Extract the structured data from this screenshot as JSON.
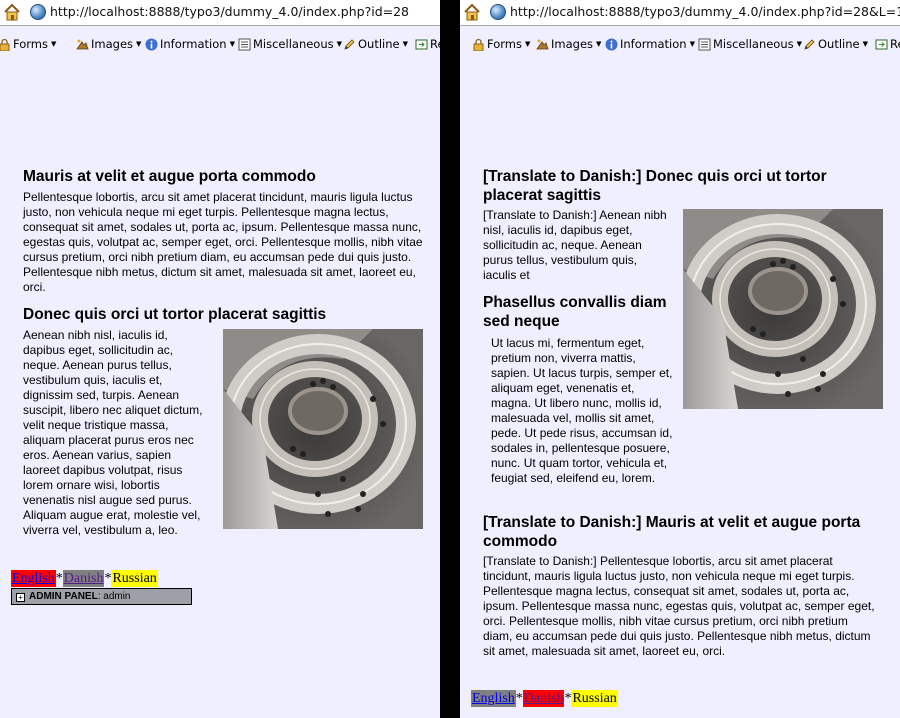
{
  "left": {
    "url": "http://localhost:8888/typo3/dummy_4.0/index.php?id=28",
    "heading1": "Mauris at velit et augue porta commodo",
    "para1": "Pellentesque lobortis, arcu sit amet placerat tincidunt, mauris ligula luctus justo, non vehicula neque mi eget turpis. Pellentesque magna lectus, consequat sit amet, sodales ut, porta ac, ipsum. Pellentesque massa nunc, egestas quis, volutpat ac, semper eget, orci. Pellentesque mollis, nibh vitae cursus pretium, orci nibh pretium diam, eu accumsan pede dui quis justo. Pellentesque nibh metus, dictum sit amet, malesuada sit amet, laoreet eu, orci.",
    "heading2": "Donec quis orci ut tortor placerat sagittis",
    "para2": "Aenean nibh nisl, iaculis id, dapibus eget, sollicitudin ac, neque. Aenean purus tellus, vestibulum quis, iaculis et, dignissim sed, turpis. Aenean suscipit, libero nec aliquet dictum, velit neque tristique massa, aliquam placerat purus eros nec eros. Aenean varius, sapien laoreet dapibus volutpat, risus lorem ornare wisi, lobortis venenatis nisl augue sed purus. Aliquam augue erat, molestie vel, viverra vel, vestibulum a, leo.",
    "lang_english": "English",
    "lang_danish": "Danish",
    "lang_russian": "Russian",
    "lang_sep": "*",
    "admin_label": "ADMIN PANEL",
    "admin_user": ": admin"
  },
  "right": {
    "url": "http://localhost:8888/typo3/dummy_4.0/index.php?id=28&L=1",
    "heading1": "[Translate to Danish:] Donec quis orci ut tortor placerat sagittis",
    "para1": "[Translate to Danish:] Aenean nibh nisl, iaculis id, dapibus eget, sollicitudin ac, neque. Aenean purus tellus, vestibulum quis, iaculis et",
    "heading2": "Phasellus convallis diam sed neque",
    "para2": "Ut lacus mi, fermentum eget, pretium non, viverra mattis, sapien. Ut lacus turpis, semper et, aliquam eget, venenatis et, magna. Ut libero nunc, mollis id, malesuada vel, mollis sit amet, pede. Ut pede risus, accumsan id, sodales in, pellentesque posuere, nunc. Ut quam tortor, vehicula et, feugiat sed, eleifend eu, lorem.",
    "heading3": "[Translate to Danish:] Mauris at velit et augue porta commodo",
    "para3": "[Translate to Danish:] Pellentesque lobortis, arcu sit amet placerat tincidunt, mauris ligula luctus justo, non vehicula neque mi eget turpis. Pellentesque magna lectus, consequat sit amet, sodales ut, porta ac, ipsum. Pellentesque massa nunc, egestas quis, volutpat ac, semper eget, orci. Pellentesque mollis, nibh vitae cursus pretium, orci nibh pretium diam, eu accumsan pede dui quis justo. Pellentesque nibh metus, dictum sit amet, malesuada sit amet, laoreet eu, orci.",
    "lang_english": "English",
    "lang_danish": "Danish",
    "lang_russian": "Russian",
    "lang_sep": "*"
  },
  "toolbar": {
    "forms": "Forms",
    "images": "Images",
    "information": "Information",
    "miscellaneous": "Miscellaneous",
    "outline": "Outline",
    "resize_partial": "Re",
    "icons": [
      "forms-lock-icon",
      "images-icon",
      "information-icon",
      "miscellaneous-icon",
      "outline-pencil-icon",
      "resize-icon"
    ]
  },
  "colors": {
    "page_bg": "#f0efff",
    "active_lang_bg": "#ff0000",
    "inactive_lang_bg": "#808080",
    "unavailable_lang_bg": "#ffff00",
    "link_color": "#0000ee",
    "visited_color": "#551a8b"
  }
}
